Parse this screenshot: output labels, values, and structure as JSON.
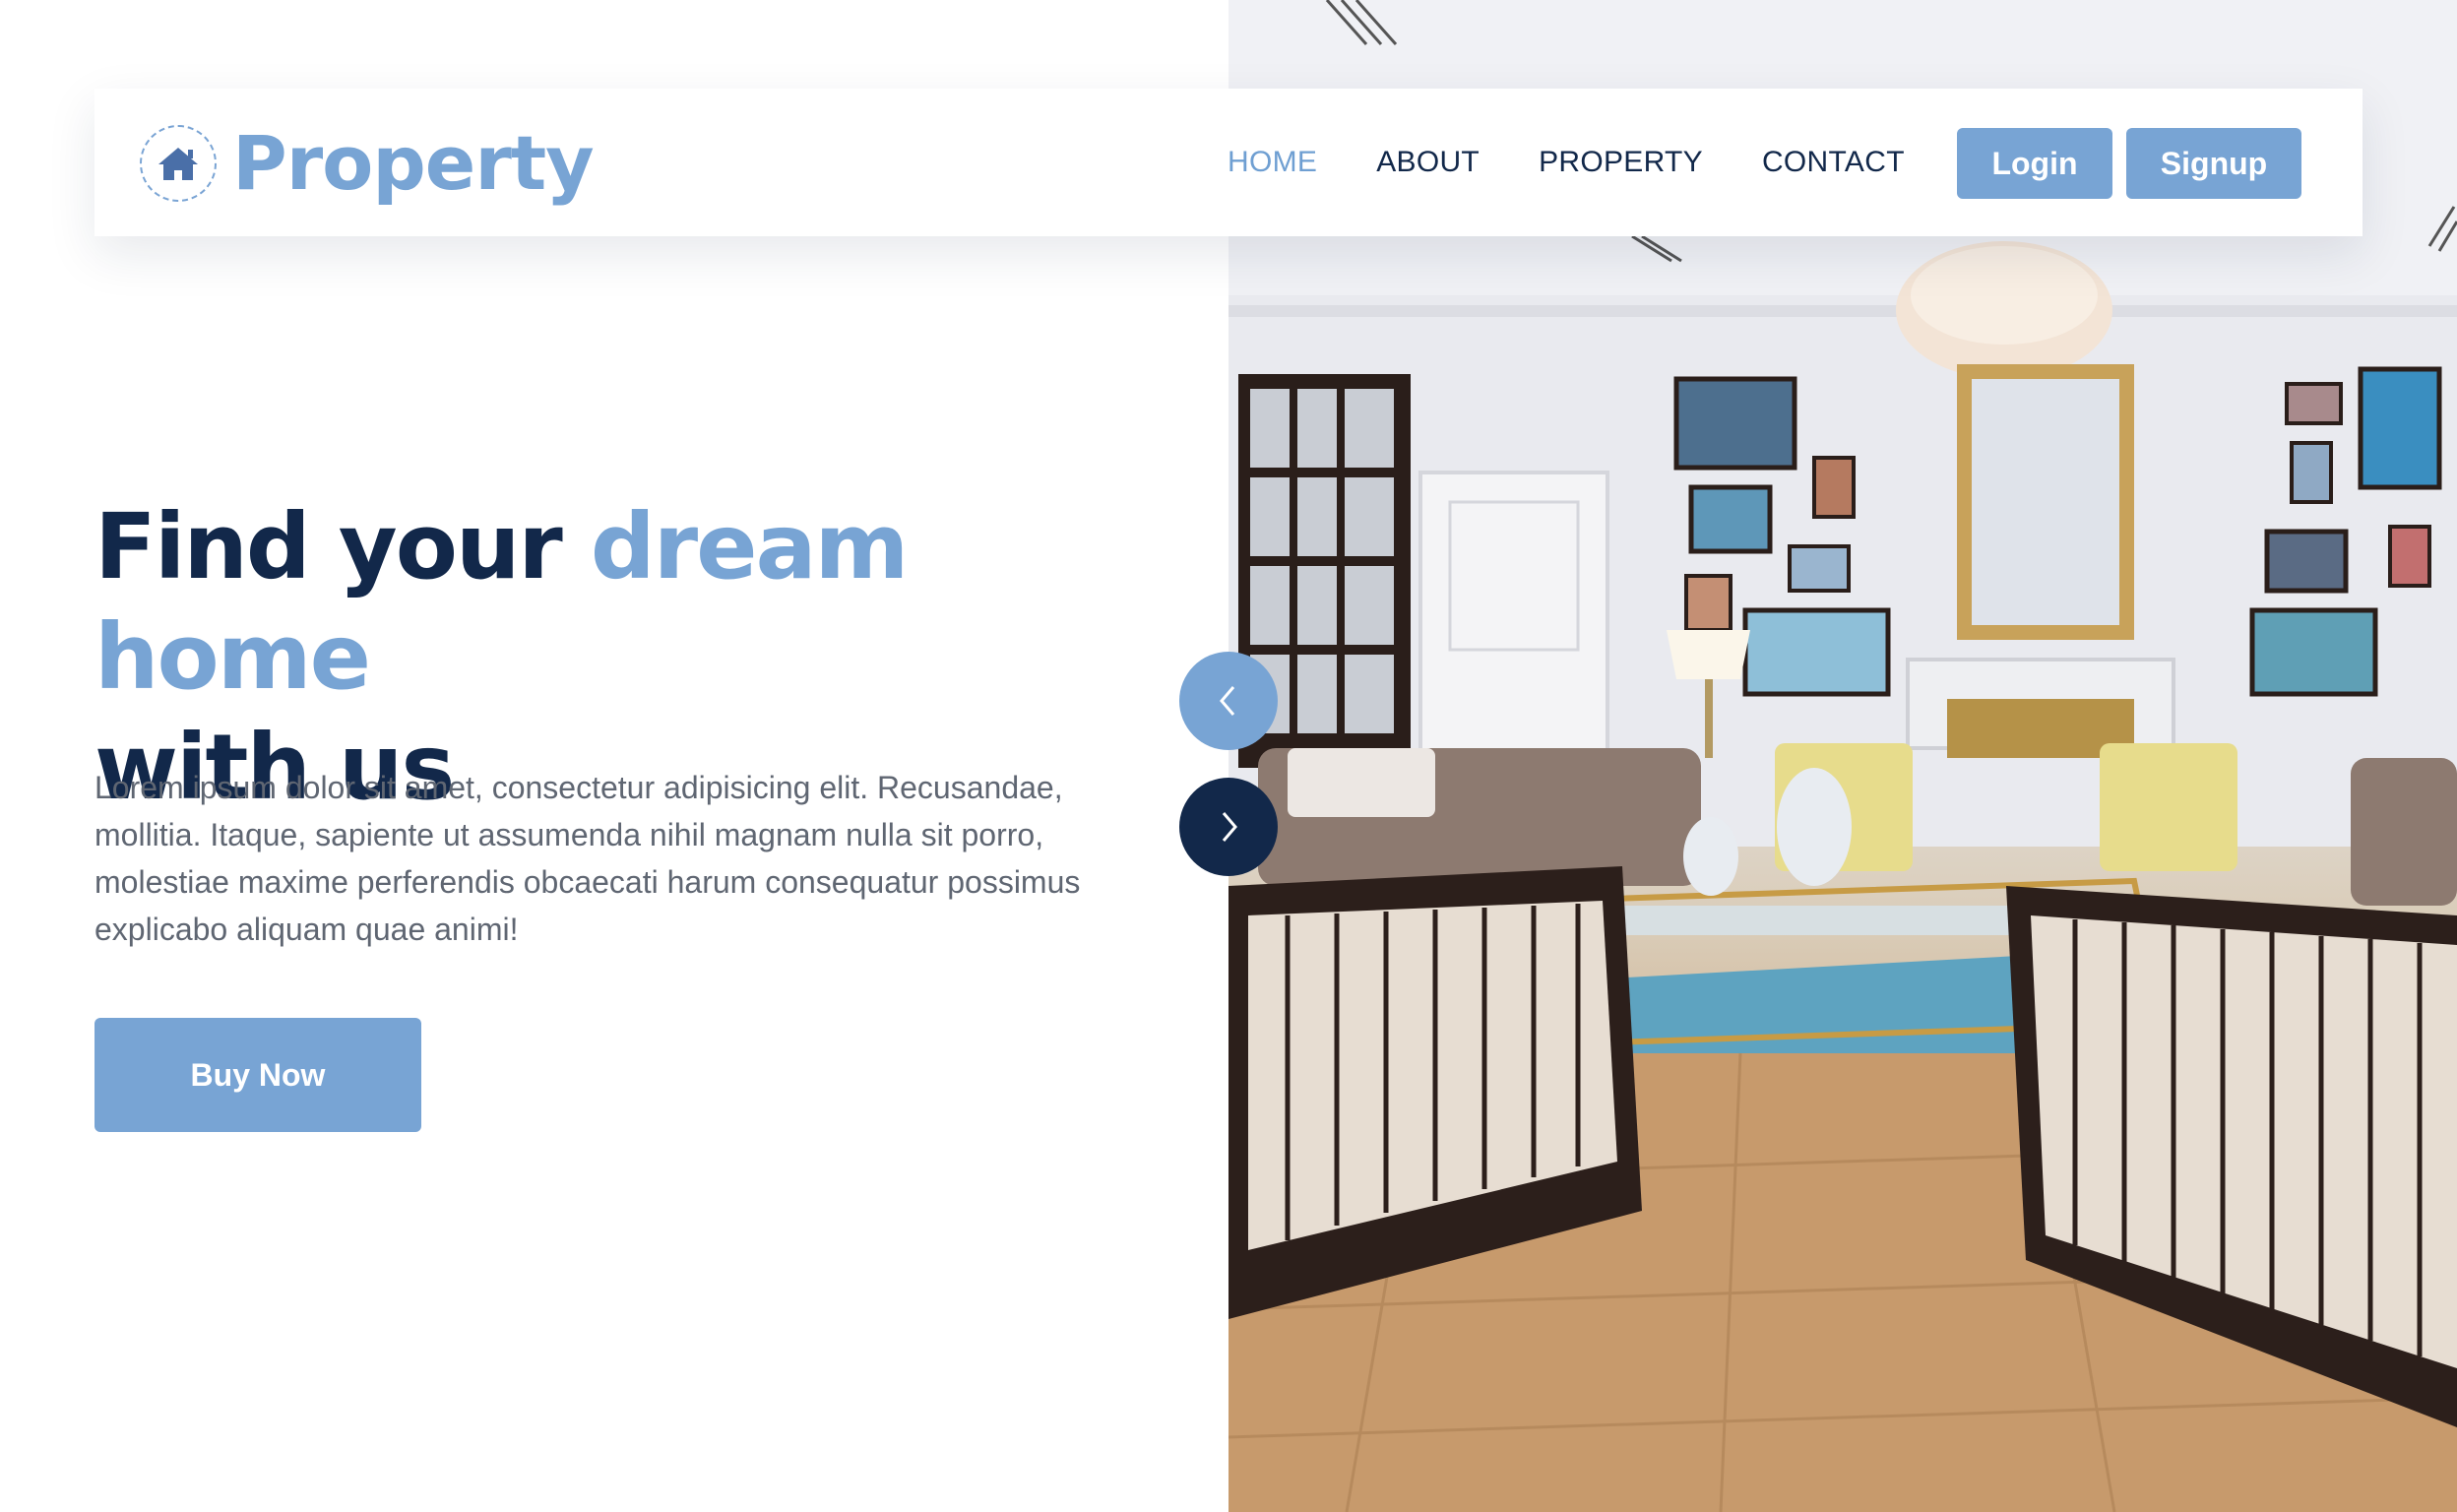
{
  "brand": {
    "name": "Property",
    "icon": "house-icon"
  },
  "nav": {
    "items": [
      {
        "label": "HOME",
        "active": true
      },
      {
        "label": "ABOUT",
        "active": false
      },
      {
        "label": "PROPERTY",
        "active": false
      },
      {
        "label": "CONTACT",
        "active": false
      }
    ],
    "login_label": "Login",
    "signup_label": "Signup"
  },
  "hero": {
    "headline_part1": "Find your ",
    "headline_accent": "dream home",
    "headline_part2": "with us",
    "description": "Lorem ipsum dolor sit amet, consectetur adipisicing elit. Recusandae, mollitia. Itaque, sapiente ut assumenda nihil magnam nulla sit porro, molestiae maxime perferendis obcaecati harum consequatur possimus explicabo aliquam quae animi!",
    "cta_label": "Buy Now",
    "image": "living-room-interior-photo"
  },
  "slider": {
    "prev_icon": "chevron-left-icon",
    "next_icon": "chevron-right-icon"
  },
  "colors": {
    "accent": "#78a4d4",
    "navy": "#12284a",
    "body_text": "#5f6672",
    "white": "#ffffff"
  }
}
